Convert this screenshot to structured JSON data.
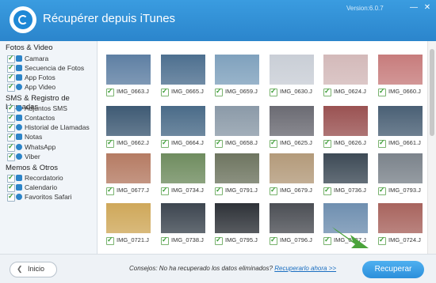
{
  "app": {
    "title": "Récupérer depuis iTunes",
    "version": "Version:6.0.7",
    "controls": [
      "—",
      "✕"
    ]
  },
  "sidebar": {
    "groups": [
      {
        "title": "Fotos & Video",
        "items": [
          "Camara",
          "Secuencia de Fotos",
          "App Fotos",
          "App Video"
        ]
      },
      {
        "title": "SMS & Registro de Llamadas",
        "items": [
          "Adjuntos SMS",
          "Contactos",
          "Historial de Llamadas",
          "Notas",
          "WhatsApp",
          "Viber"
        ]
      },
      {
        "title": "Memos & Otros",
        "items": [
          "Recordatorio",
          "Calendario",
          "Favoritos Safari"
        ]
      }
    ]
  },
  "photos": [
    {
      "name": "IMG_0663.J",
      "color": "#5e7fa3"
    },
    {
      "name": "IMG_0665.J",
      "color": "#4d6f8f"
    },
    {
      "name": "IMG_0659.J",
      "color": "#7fa1bd"
    },
    {
      "name": "IMG_0630.J",
      "color": "#c9ced6"
    },
    {
      "name": "IMG_0624.J",
      "color": "#d3b9b9"
    },
    {
      "name": "IMG_0660.J",
      "color": "#c77c7c"
    },
    {
      "name": "IMG_0662.J",
      "color": "#3e5a74"
    },
    {
      "name": "IMG_0664.J",
      "color": "#4a6b88"
    },
    {
      "name": "IMG_0658.J",
      "color": "#8b9aa8"
    },
    {
      "name": "IMG_0625.J",
      "color": "#6b6b73"
    },
    {
      "name": "IMG_0626.J",
      "color": "#9a5252"
    },
    {
      "name": "IMG_0661.J",
      "color": "#4a6075"
    },
    {
      "name": "IMG_0677.J",
      "color": "#b57b63"
    },
    {
      "name": "IMG_0734.J",
      "color": "#6f8c5f"
    },
    {
      "name": "IMG_0791.J",
      "color": "#6e7560"
    },
    {
      "name": "IMG_0679.J",
      "color": "#b39a7a"
    },
    {
      "name": "IMG_0736.J",
      "color": "#3d4a56"
    },
    {
      "name": "IMG_0793.J",
      "color": "#7b838b"
    },
    {
      "name": "IMG_0721.J",
      "color": "#cfa85a"
    },
    {
      "name": "IMG_0738.J",
      "color": "#3d4650"
    },
    {
      "name": "IMG_0795.J",
      "color": "#2e3238"
    },
    {
      "name": "IMG_0796.J",
      "color": "#4c4f55"
    },
    {
      "name": "IMG_0737.J",
      "color": "#6f8fb0"
    },
    {
      "name": "IMG_0724.J",
      "color": "#a8645e"
    }
  ],
  "footer": {
    "back_label": "Inicio",
    "tip_text": "Consejos: No ha recuperado los datos eliminados?",
    "tip_link": "Recuperarlo ahora >>",
    "recover_label": "Recuperar"
  },
  "colors": {
    "accent": "#2b85cc",
    "check": "#3fa03a",
    "arrow": "#4aa33a"
  }
}
